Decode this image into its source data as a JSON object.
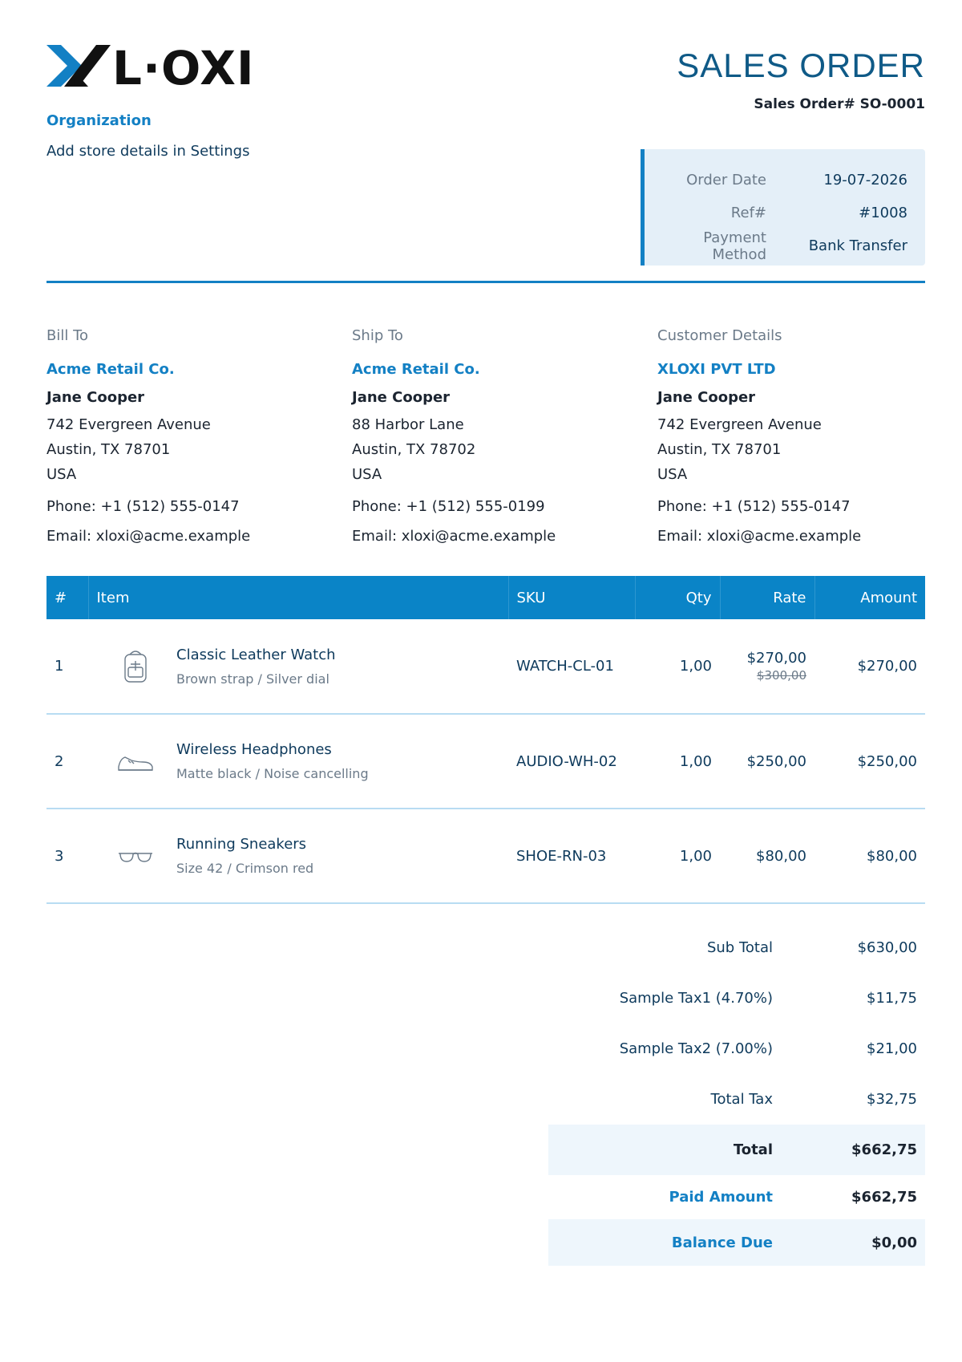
{
  "brand": {
    "name": "L·OXI",
    "accent": "#1380c4"
  },
  "org": {
    "label": "Organization",
    "note": "Add store details in Settings"
  },
  "document": {
    "title": "SALES ORDER",
    "number": "Sales Order# SO-0001"
  },
  "meta": [
    {
      "key": "Order Date",
      "value": "19-07-2026"
    },
    {
      "key": "Ref#",
      "value": "#1008"
    },
    {
      "key": "Payment Method",
      "value": "Bank Transfer"
    }
  ],
  "addresses": [
    {
      "heading": "Bill To",
      "company": "Acme Retail Co.",
      "name": "Jane Cooper",
      "lines": [
        "742 Evergreen Avenue",
        "Austin, TX 78701",
        "USA"
      ],
      "phone": "Phone: +1 (512) 555-0147",
      "email": "Email: xloxi@acme.example"
    },
    {
      "heading": "Ship To",
      "company": "Acme Retail Co.",
      "name": "Jane Cooper",
      "lines": [
        "88 Harbor Lane",
        "Austin, TX 78702",
        "USA"
      ],
      "phone": "Phone: +1 (512) 555-0199",
      "email": "Email: xloxi@acme.example"
    },
    {
      "heading": "Customer Details",
      "company": "XLOXI PVT LTD",
      "name": "Jane Cooper",
      "lines": [
        "742 Evergreen Avenue",
        "Austin, TX 78701",
        "USA"
      ],
      "phone": "Phone: +1 (512) 555-0147",
      "email": "Email: xloxi@acme.example"
    }
  ],
  "table": {
    "headers": [
      "#",
      "Item",
      "SKU",
      "Qty",
      "Rate",
      "Amount"
    ],
    "rows": [
      {
        "index": "1",
        "icon": "backpack-icon",
        "name": "Classic Leather Watch",
        "desc": "Brown strap / Silver dial",
        "sku": "WATCH-CL-01",
        "qty": "1,00",
        "rate": "$270,00",
        "old_rate": "$300,00",
        "amount": "$270,00"
      },
      {
        "index": "2",
        "icon": "sneaker-icon",
        "name": "Wireless Headphones",
        "desc": "Matte black / Noise cancelling",
        "sku": "AUDIO-WH-02",
        "qty": "1,00",
        "rate": "$250,00",
        "old_rate": "",
        "amount": "$250,00"
      },
      {
        "index": "3",
        "icon": "glasses-icon",
        "name": "Running Sneakers",
        "desc": "Size 42 / Crimson red",
        "sku": "SHOE-RN-03",
        "qty": "1,00",
        "rate": "$80,00",
        "old_rate": "",
        "amount": "$80,00"
      }
    ]
  },
  "totals": [
    {
      "label": "Sub Total",
      "value": "$630,00",
      "style": "plain"
    },
    {
      "label": "Sample Tax1 (4.70%)",
      "value": "$11,75",
      "style": "plain"
    },
    {
      "label": "Sample Tax2 (7.00%)",
      "value": "$21,00",
      "style": "plain"
    },
    {
      "label": "Total Tax",
      "value": "$32,75",
      "style": "plain"
    },
    {
      "label": "Total",
      "value": "$662,75",
      "style": "total"
    },
    {
      "label": "Paid Amount",
      "value": "$662,75",
      "style": "paid"
    },
    {
      "label": "Balance Due",
      "value": "$0,00",
      "style": "due"
    }
  ]
}
